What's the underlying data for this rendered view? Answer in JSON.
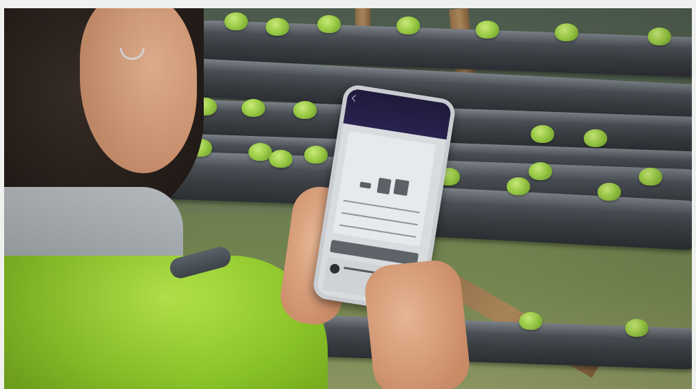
{
  "photo": {
    "description_free": true,
    "phone_screen": {
      "title": "",
      "tabs": [
        "",
        ""
      ],
      "card_title": ""
    }
  }
}
